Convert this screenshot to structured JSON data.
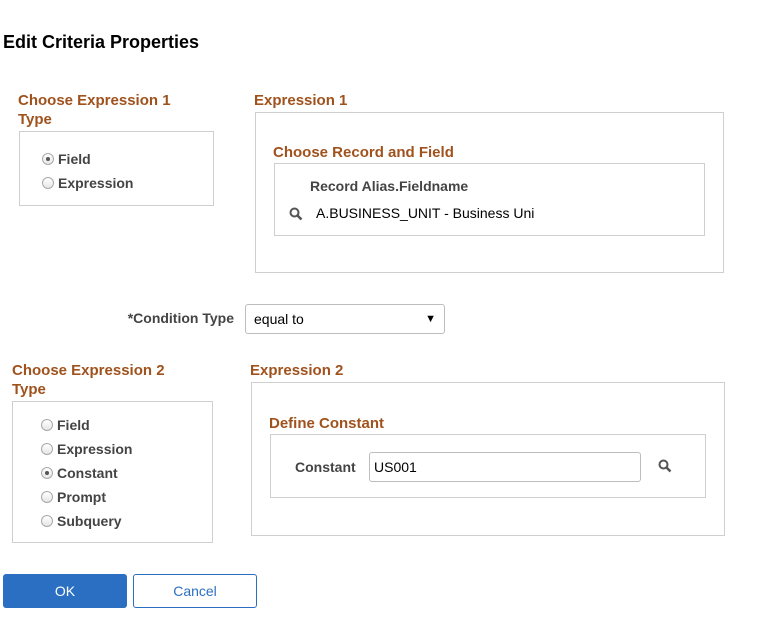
{
  "title": "Edit Criteria Properties",
  "expr1_type": {
    "label": "Choose Expression 1 Type",
    "options": [
      "Field",
      "Expression"
    ],
    "selected": "Field"
  },
  "expr1": {
    "label": "Expression 1",
    "section": "Choose Record and Field",
    "column_header": "Record Alias.Fieldname",
    "value": "A.BUSINESS_UNIT - Business Uni"
  },
  "condition": {
    "label": "*Condition Type",
    "value": "equal to"
  },
  "expr2_type": {
    "label": "Choose Expression 2 Type",
    "options": [
      "Field",
      "Expression",
      "Constant",
      "Prompt",
      "Subquery"
    ],
    "selected": "Constant"
  },
  "expr2": {
    "label": "Expression 2",
    "section": "Define Constant",
    "field_label": "Constant",
    "value": "US001"
  },
  "buttons": {
    "ok": "OK",
    "cancel": "Cancel"
  },
  "colors": {
    "accent": "#a0521d",
    "primary": "#2b6fc2"
  }
}
